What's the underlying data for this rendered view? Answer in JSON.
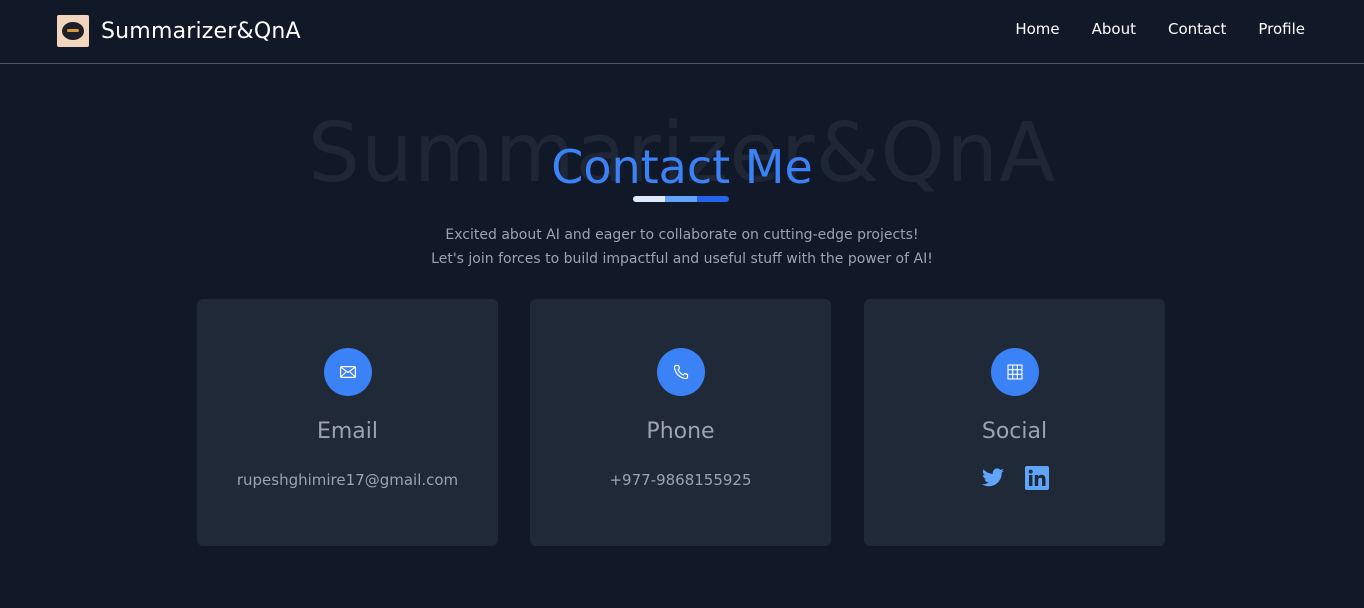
{
  "navbar": {
    "brand": "Summarizer&QnA",
    "links": [
      "Home",
      "About",
      "Contact",
      "Profile"
    ]
  },
  "hero": {
    "watermark": "Summarizer&QnA",
    "title": "Contact Me",
    "subtitle_line1": "Excited about AI and eager to collaborate on cutting-edge projects!",
    "subtitle_line2": "Let's join forces to build impactful and useful stuff with the power of AI!"
  },
  "cards": [
    {
      "icon": "mail-icon",
      "title": "Email",
      "value": "rupeshghimire17@gmail.com"
    },
    {
      "icon": "phone-icon",
      "title": "Phone",
      "value": "+977-9868155925"
    },
    {
      "icon": "grid-icon",
      "title": "Social",
      "links": [
        "twitter-icon",
        "linkedin-icon"
      ]
    }
  ],
  "colors": {
    "background": "#111827",
    "card": "#1f2937",
    "accent": "#3b82f6",
    "muted_text": "#9ca3af"
  }
}
